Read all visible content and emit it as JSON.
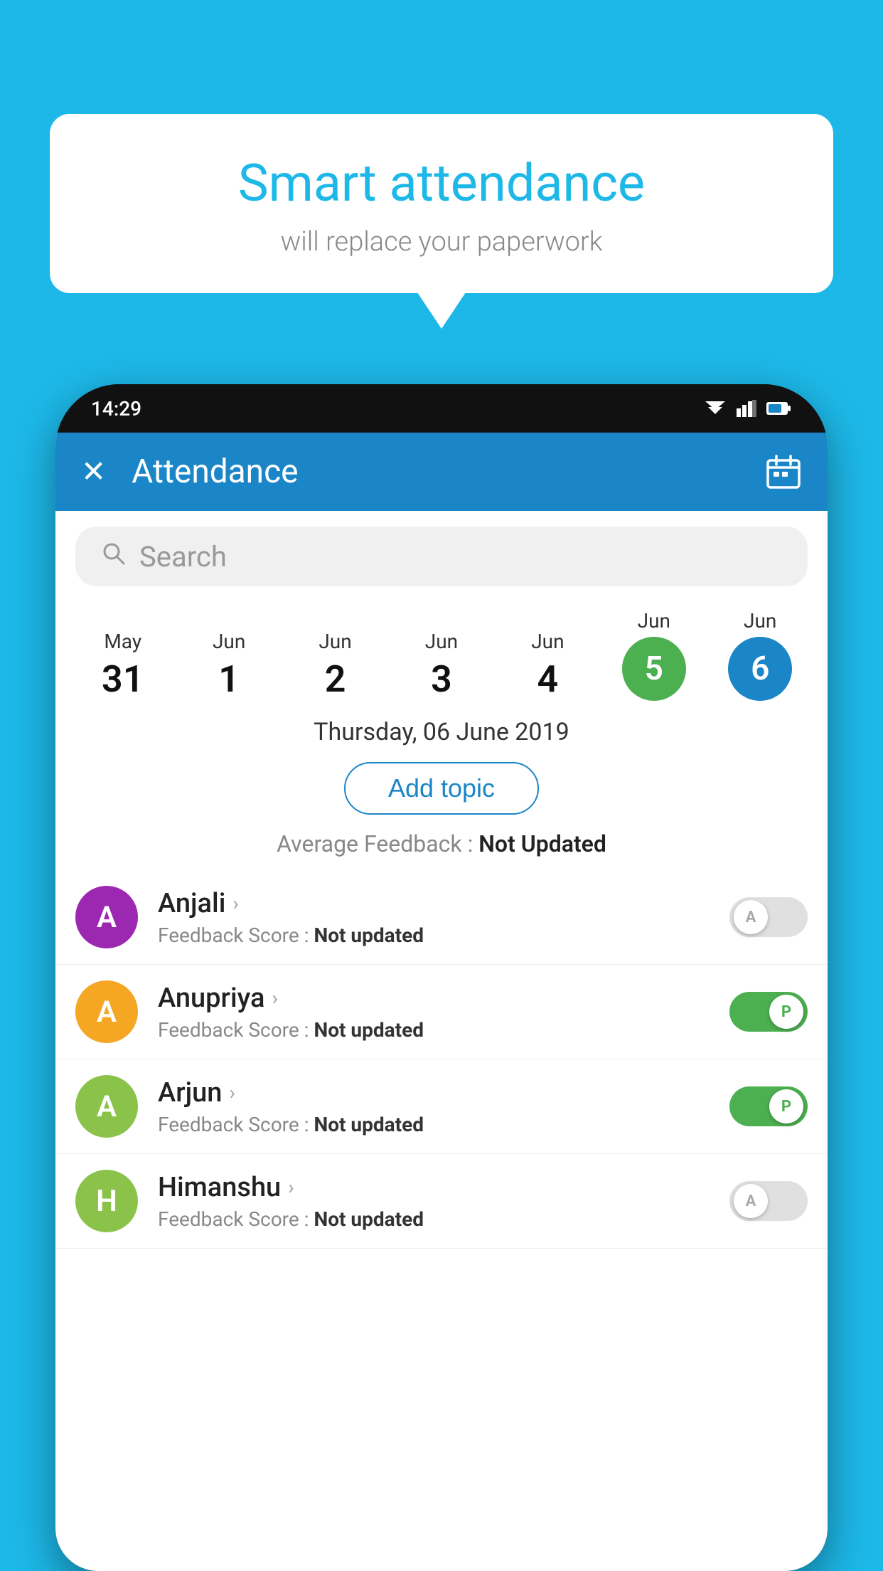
{
  "background_color": "#1DB8E8",
  "speech_bubble": {
    "title": "Smart attendance",
    "subtitle": "will replace your paperwork"
  },
  "phone": {
    "time": "14:29",
    "header": {
      "title": "Attendance",
      "close_label": "✕",
      "calendar_icon": "calendar-icon"
    },
    "search": {
      "placeholder": "Search"
    },
    "dates": [
      {
        "month": "May",
        "day": "31",
        "state": "normal"
      },
      {
        "month": "Jun",
        "day": "1",
        "state": "normal"
      },
      {
        "month": "Jun",
        "day": "2",
        "state": "normal"
      },
      {
        "month": "Jun",
        "day": "3",
        "state": "normal"
      },
      {
        "month": "Jun",
        "day": "4",
        "state": "normal"
      },
      {
        "month": "Jun",
        "day": "5",
        "state": "today"
      },
      {
        "month": "Jun",
        "day": "6",
        "state": "selected"
      }
    ],
    "selected_date_label": "Thursday, 06 June 2019",
    "add_topic_button": "Add topic",
    "average_feedback_label": "Average Feedback :",
    "average_feedback_value": "Not Updated",
    "students": [
      {
        "name": "Anjali",
        "avatar_letter": "A",
        "avatar_color": "#9C27B0",
        "feedback_label": "Feedback Score :",
        "feedback_value": "Not updated",
        "attendance": "absent",
        "toggle_letter": "A"
      },
      {
        "name": "Anupriya",
        "avatar_letter": "A",
        "avatar_color": "#F5A623",
        "feedback_label": "Feedback Score :",
        "feedback_value": "Not updated",
        "attendance": "present",
        "toggle_letter": "P"
      },
      {
        "name": "Arjun",
        "avatar_letter": "A",
        "avatar_color": "#8BC34A",
        "feedback_label": "Feedback Score :",
        "feedback_value": "Not updated",
        "attendance": "present",
        "toggle_letter": "P"
      },
      {
        "name": "Himanshu",
        "avatar_letter": "H",
        "avatar_color": "#8BC34A",
        "feedback_label": "Feedback Score :",
        "feedback_value": "Not updated",
        "attendance": "absent",
        "toggle_letter": "A"
      }
    ]
  }
}
